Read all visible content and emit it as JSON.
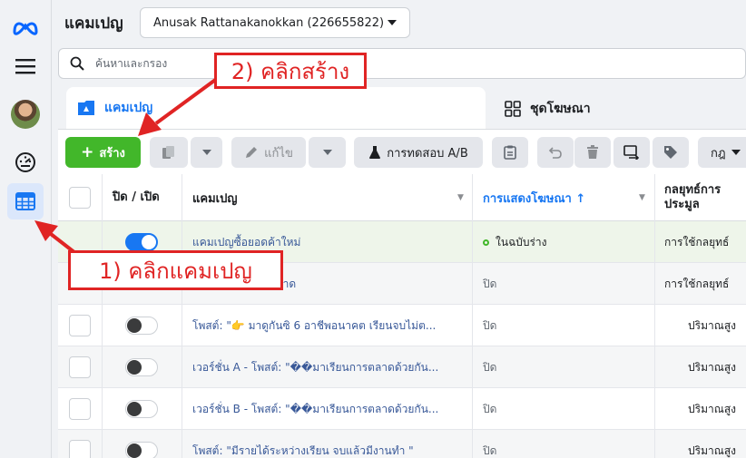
{
  "rail": {
    "items": [
      {
        "name": "meta-logo-icon"
      },
      {
        "name": "menu-icon"
      },
      {
        "name": "avatar"
      },
      {
        "name": "dashboard-icon"
      },
      {
        "name": "campaigns-table-icon",
        "active": true
      }
    ]
  },
  "header": {
    "title": "แคมเปญ",
    "account": "Anusak Rattanakanokkan (226655822)"
  },
  "search": {
    "placeholder": "ค้นหาและกรอง"
  },
  "tabs": {
    "campaigns": "แคมเปญ",
    "ad_sets": "ชุดโฆษณา"
  },
  "toolbar": {
    "create": "สร้าง",
    "edit": "แก้ไข",
    "ab_test": "การทดสอบ A/B",
    "rules": "กฎ"
  },
  "table": {
    "headers": {
      "on_off": "ปิด / เปิด",
      "campaign": "แคมเปญ",
      "delivery": "การแสดงโฆษณา ↑",
      "bid_strategy": "กลยุทธ์การ ประมูล"
    },
    "rows": [
      {
        "on": true,
        "name": "แคมเปญซื้อยอดค้าใหม่",
        "delivery": "ในฉบับร่าง",
        "bid": "การใช้กลยุทธ์",
        "draft": true
      },
      {
        "on": null,
        "name": "การตลาด",
        "delivery": "ปิด",
        "bid": "การใช้กลยุทธ์"
      },
      {
        "on": false,
        "name": "โพสต์: \"👉 มาดูกันซิ 6 อาชีพอนาคต เรียนจบไม่ต...",
        "delivery": "ปิด",
        "bid": "ปริมาณสูง"
      },
      {
        "on": false,
        "name": "เวอร์ชั่น A - โพสต์: \"��มาเรียนการตลาดด้วยกัน...",
        "delivery": "ปิด",
        "bid": "ปริมาณสูง"
      },
      {
        "on": false,
        "name": "เวอร์ชั่น B - โพสต์: \"��มาเรียนการตลาดด้วยกัน...",
        "delivery": "ปิด",
        "bid": "ปริมาณสูง"
      },
      {
        "on": false,
        "name": "โพสต์: \"มีรายได้ระหว่างเรียน จบแล้วมีงานทำ \"",
        "delivery": "ปิด",
        "bid": "ปริมาณสูง"
      }
    ]
  },
  "annotations": {
    "step1": "1) คลิกแคมเปญ",
    "step2": "2) คลิกสร้าง"
  },
  "colors": {
    "accent": "#1877f2",
    "create_green": "#42b72a",
    "annotation_red": "#e02424"
  }
}
